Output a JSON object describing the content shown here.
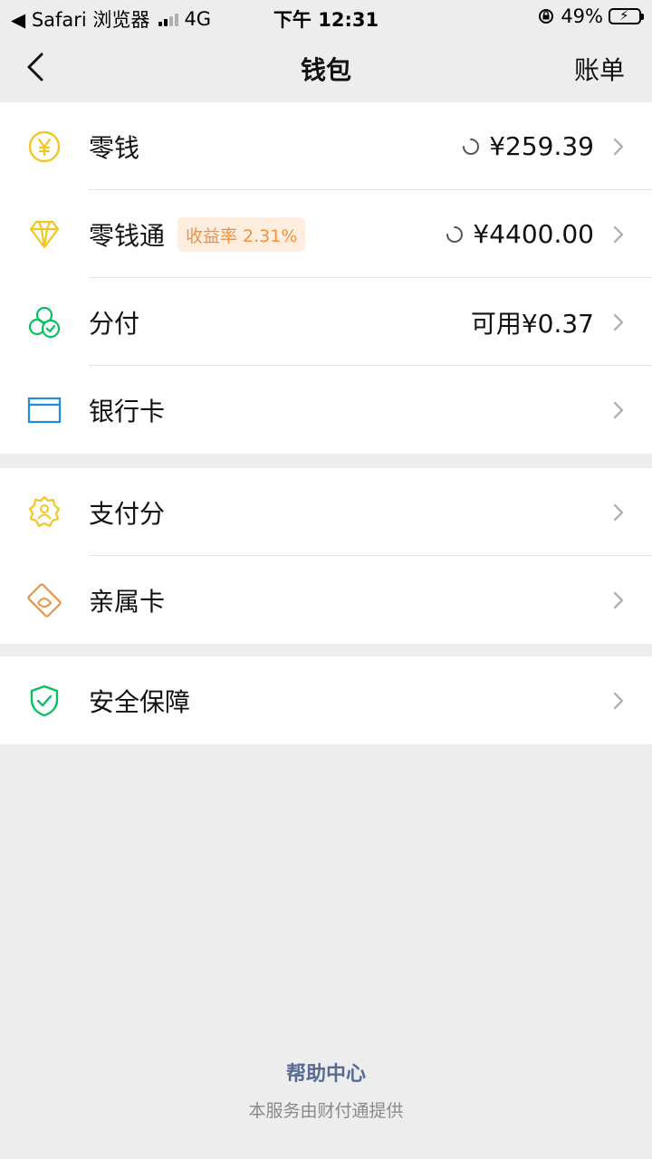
{
  "status_bar": {
    "back_app": "◀ Safari 浏览器",
    "network": "4G",
    "time": "下午 12:31",
    "battery": "49%"
  },
  "nav": {
    "title": "钱包",
    "action": "账单"
  },
  "group1": [
    {
      "label": "零钱",
      "value": "¥259.39",
      "icon": "yuan-coin-icon"
    },
    {
      "label": "零钱通",
      "badge": "收益率 2.31%",
      "value": "¥4400.00",
      "icon": "diamond-icon"
    },
    {
      "label": "分付",
      "value": "可用¥0.37",
      "icon": "fenfu-icon"
    },
    {
      "label": "银行卡",
      "value": "",
      "icon": "bank-card-icon"
    }
  ],
  "group2": [
    {
      "label": "支付分",
      "icon": "pay-score-icon"
    },
    {
      "label": "亲属卡",
      "icon": "family-card-icon"
    }
  ],
  "group3": [
    {
      "label": "安全保障",
      "icon": "shield-check-icon"
    }
  ],
  "footer": {
    "help": "帮助中心",
    "note": "本服务由财付通提供"
  },
  "colors": {
    "yellow": "#f3c623",
    "green": "#07c160",
    "blue": "#1f8ce0",
    "orange": "#f0913c",
    "link": "#576b95"
  }
}
